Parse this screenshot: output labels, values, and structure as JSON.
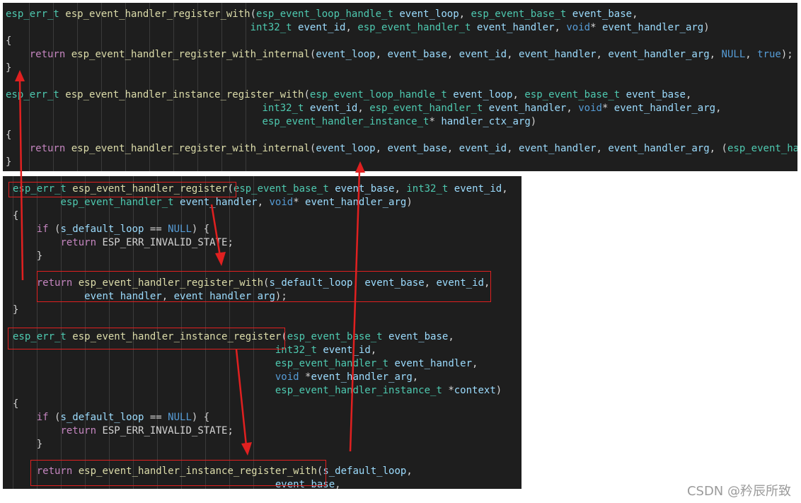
{
  "top_panel": {
    "lines": [
      [
        [
          "esp_err_t",
          "type"
        ],
        [
          " ",
          "punc"
        ],
        [
          "esp_event_handler_register_with",
          "fn"
        ],
        [
          "(",
          "punc"
        ],
        [
          "esp_event_loop_handle_t",
          "type"
        ],
        [
          " ",
          "punc"
        ],
        [
          "event_loop",
          "var"
        ],
        [
          ", ",
          "punc"
        ],
        [
          "esp_event_base_t",
          "type"
        ],
        [
          " ",
          "punc"
        ],
        [
          "event_base",
          "var"
        ],
        [
          ",",
          "punc"
        ]
      ],
      [
        [
          "                                         ",
          "punc"
        ],
        [
          "int32_t",
          "type"
        ],
        [
          " ",
          "punc"
        ],
        [
          "event_id",
          "var"
        ],
        [
          ", ",
          "punc"
        ],
        [
          "esp_event_handler_t",
          "type"
        ],
        [
          " ",
          "punc"
        ],
        [
          "event_handler",
          "var"
        ],
        [
          ", ",
          "punc"
        ],
        [
          "void",
          "kw"
        ],
        [
          "* ",
          "punc"
        ],
        [
          "event_handler_arg",
          "var"
        ],
        [
          ")",
          "punc"
        ]
      ],
      [
        [
          "{",
          "punc"
        ]
      ],
      [
        [
          "    ",
          "punc"
        ],
        [
          "return",
          "ctl"
        ],
        [
          " ",
          "punc"
        ],
        [
          "esp_event_handler_register_with_internal",
          "fn"
        ],
        [
          "(",
          "punc"
        ],
        [
          "event_loop",
          "var"
        ],
        [
          ", ",
          "punc"
        ],
        [
          "event_base",
          "var"
        ],
        [
          ", ",
          "punc"
        ],
        [
          "event_id",
          "var"
        ],
        [
          ", ",
          "punc"
        ],
        [
          "event_handler",
          "var"
        ],
        [
          ", ",
          "punc"
        ],
        [
          "event_handler_arg",
          "var"
        ],
        [
          ", ",
          "punc"
        ],
        [
          "NULL",
          "kw"
        ],
        [
          ", ",
          "punc"
        ],
        [
          "true",
          "kw"
        ],
        [
          ");",
          "punc"
        ]
      ],
      [
        [
          "}",
          "punc"
        ]
      ],
      [
        [
          "",
          "punc"
        ]
      ],
      [
        [
          "esp_err_t",
          "type"
        ],
        [
          " ",
          "punc"
        ],
        [
          "esp_event_handler_instance_register_with",
          "fn"
        ],
        [
          "(",
          "punc"
        ],
        [
          "esp_event_loop_handle_t",
          "type"
        ],
        [
          " ",
          "punc"
        ],
        [
          "event_loop",
          "var"
        ],
        [
          ", ",
          "punc"
        ],
        [
          "esp_event_base_t",
          "type"
        ],
        [
          " ",
          "punc"
        ],
        [
          "event_base",
          "var"
        ],
        [
          ",",
          "punc"
        ]
      ],
      [
        [
          "                                           ",
          "punc"
        ],
        [
          "int32_t",
          "type"
        ],
        [
          " ",
          "punc"
        ],
        [
          "event_id",
          "var"
        ],
        [
          ", ",
          "punc"
        ],
        [
          "esp_event_handler_t",
          "type"
        ],
        [
          " ",
          "punc"
        ],
        [
          "event_handler",
          "var"
        ],
        [
          ", ",
          "punc"
        ],
        [
          "void",
          "kw"
        ],
        [
          "* ",
          "punc"
        ],
        [
          "event_handler_arg",
          "var"
        ],
        [
          ",",
          "punc"
        ]
      ],
      [
        [
          "                                           ",
          "punc"
        ],
        [
          "esp_event_handler_instance_t",
          "type"
        ],
        [
          "* ",
          "punc"
        ],
        [
          "handler_ctx_arg",
          "var"
        ],
        [
          ")",
          "punc"
        ]
      ],
      [
        [
          "{",
          "punc"
        ]
      ],
      [
        [
          "    ",
          "punc"
        ],
        [
          "return",
          "ctl"
        ],
        [
          " ",
          "punc"
        ],
        [
          "esp_event_handler_register_with_internal",
          "fn"
        ],
        [
          "(",
          "punc"
        ],
        [
          "event_loop",
          "var"
        ],
        [
          ", ",
          "punc"
        ],
        [
          "event_base",
          "var"
        ],
        [
          ", ",
          "punc"
        ],
        [
          "event_id",
          "var"
        ],
        [
          ", ",
          "punc"
        ],
        [
          "event_handler",
          "var"
        ],
        [
          ", ",
          "punc"
        ],
        [
          "event_handler_arg",
          "var"
        ],
        [
          ", (",
          "punc"
        ],
        [
          "esp_event_ha",
          "type"
        ]
      ],
      [
        [
          "}",
          "punc"
        ]
      ]
    ]
  },
  "bottom_panel": {
    "lines": [
      [
        [
          "esp_err_t",
          "type"
        ],
        [
          " ",
          "punc"
        ],
        [
          "esp_event_handler_register",
          "fn"
        ],
        [
          "(",
          "punc"
        ],
        [
          "esp_event_base_t",
          "type"
        ],
        [
          " ",
          "punc"
        ],
        [
          "event_base",
          "var"
        ],
        [
          ", ",
          "punc"
        ],
        [
          "int32_t",
          "type"
        ],
        [
          " ",
          "punc"
        ],
        [
          "event_id",
          "var"
        ],
        [
          ",",
          "punc"
        ]
      ],
      [
        [
          "        ",
          "punc"
        ],
        [
          "esp_event_handler_t",
          "type"
        ],
        [
          " ",
          "punc"
        ],
        [
          "event_handler",
          "var"
        ],
        [
          ", ",
          "punc"
        ],
        [
          "void",
          "kw"
        ],
        [
          "* ",
          "punc"
        ],
        [
          "event_handler_arg",
          "var"
        ],
        [
          ")",
          "punc"
        ]
      ],
      [
        [
          "{",
          "punc"
        ]
      ],
      [
        [
          "    ",
          "punc"
        ],
        [
          "if",
          "ctl"
        ],
        [
          " (",
          "punc"
        ],
        [
          "s_default_loop",
          "var"
        ],
        [
          " == ",
          "punc"
        ],
        [
          "NULL",
          "kw"
        ],
        [
          ") {",
          "punc"
        ]
      ],
      [
        [
          "        ",
          "punc"
        ],
        [
          "return",
          "ctl"
        ],
        [
          " ",
          "punc"
        ],
        [
          "ESP_ERR_INVALID_STATE",
          "punc"
        ],
        [
          ";",
          "punc"
        ]
      ],
      [
        [
          "    }",
          "punc"
        ]
      ],
      [
        [
          "",
          "punc"
        ]
      ],
      [
        [
          "    ",
          "punc"
        ],
        [
          "return",
          "ctl"
        ],
        [
          " ",
          "punc"
        ],
        [
          "esp_event_handler_register_with",
          "fn"
        ],
        [
          "(",
          "punc"
        ],
        [
          "s_default_loop",
          "var"
        ],
        [
          ", ",
          "punc"
        ],
        [
          "event_base",
          "var"
        ],
        [
          ", ",
          "punc"
        ],
        [
          "event_id",
          "var"
        ],
        [
          ",",
          "punc"
        ]
      ],
      [
        [
          "            ",
          "punc"
        ],
        [
          "event_handler",
          "var"
        ],
        [
          ", ",
          "punc"
        ],
        [
          "event_handler_arg",
          "var"
        ],
        [
          ");",
          "punc"
        ]
      ],
      [
        [
          "}",
          "punc"
        ]
      ],
      [
        [
          "",
          "punc"
        ]
      ],
      [
        [
          "esp_err_t",
          "type"
        ],
        [
          " ",
          "punc"
        ],
        [
          "esp_event_handler_instance_register",
          "fn"
        ],
        [
          "(",
          "punc"
        ],
        [
          "esp_event_base_t",
          "type"
        ],
        [
          " ",
          "punc"
        ],
        [
          "event_base",
          "var"
        ],
        [
          ",",
          "punc"
        ]
      ],
      [
        [
          "                                            ",
          "punc"
        ],
        [
          "int32_t",
          "type"
        ],
        [
          " ",
          "punc"
        ],
        [
          "event_id",
          "var"
        ],
        [
          ",",
          "punc"
        ]
      ],
      [
        [
          "                                            ",
          "punc"
        ],
        [
          "esp_event_handler_t",
          "type"
        ],
        [
          " ",
          "punc"
        ],
        [
          "event_handler",
          "var"
        ],
        [
          ",",
          "punc"
        ]
      ],
      [
        [
          "                                            ",
          "punc"
        ],
        [
          "void",
          "kw"
        ],
        [
          " *",
          "punc"
        ],
        [
          "event_handler_arg",
          "var"
        ],
        [
          ",",
          "punc"
        ]
      ],
      [
        [
          "                                            ",
          "punc"
        ],
        [
          "esp_event_handler_instance_t",
          "type"
        ],
        [
          " *",
          "punc"
        ],
        [
          "context",
          "var"
        ],
        [
          ")",
          "punc"
        ]
      ],
      [
        [
          "{",
          "punc"
        ]
      ],
      [
        [
          "    ",
          "punc"
        ],
        [
          "if",
          "ctl"
        ],
        [
          " (",
          "punc"
        ],
        [
          "s_default_loop",
          "var"
        ],
        [
          " == ",
          "punc"
        ],
        [
          "NULL",
          "kw"
        ],
        [
          ") {",
          "punc"
        ]
      ],
      [
        [
          "        ",
          "punc"
        ],
        [
          "return",
          "ctl"
        ],
        [
          " ",
          "punc"
        ],
        [
          "ESP_ERR_INVALID_STATE",
          "punc"
        ],
        [
          ";",
          "punc"
        ]
      ],
      [
        [
          "    }",
          "punc"
        ]
      ],
      [
        [
          "",
          "punc"
        ]
      ],
      [
        [
          "    ",
          "punc"
        ],
        [
          "return",
          "ctl"
        ],
        [
          " ",
          "punc"
        ],
        [
          "esp_event_handler_instance_register_with",
          "fn"
        ],
        [
          "(",
          "punc"
        ],
        [
          "s_default_loop",
          "var"
        ],
        [
          ",",
          "punc"
        ]
      ],
      [
        [
          "                                            ",
          "punc"
        ],
        [
          "event_base",
          "var"
        ],
        [
          ",",
          "punc"
        ]
      ]
    ]
  },
  "colors": {
    "editor_background": "#1e1e1e",
    "annotation_red": "#e02020"
  },
  "watermark": "CSDN @矜辰所致"
}
